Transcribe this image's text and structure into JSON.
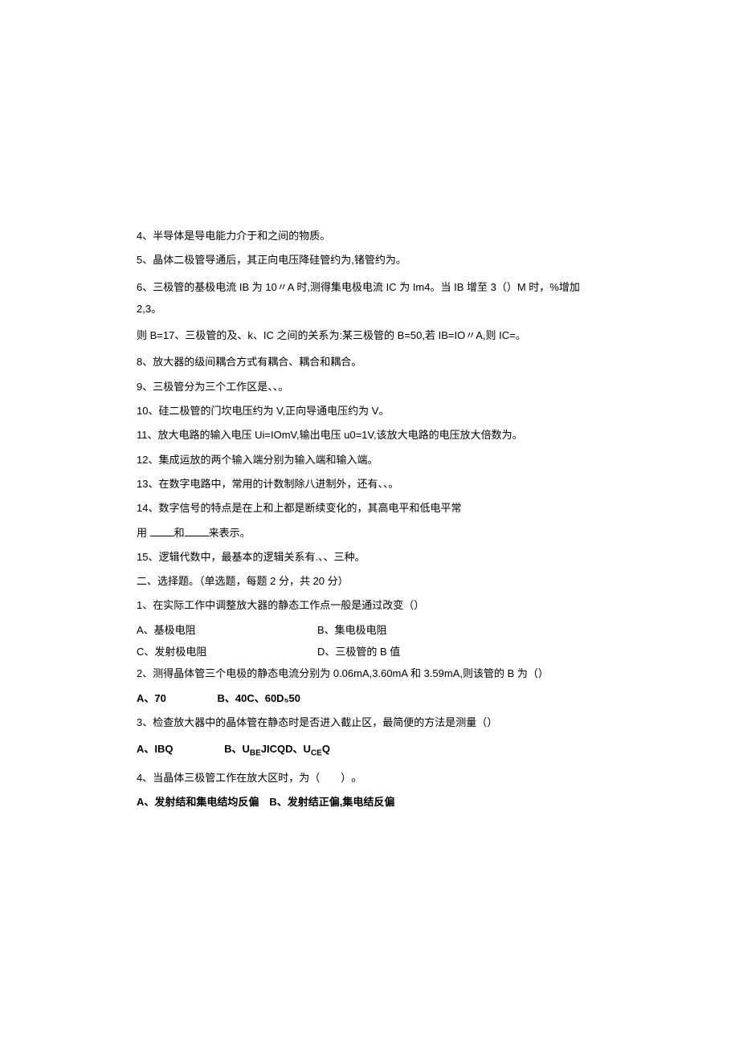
{
  "fill_blanks": {
    "q4": "4、半导体是导电能力介于和之间的物质。",
    "q5": "5、晶体二极管导通后，其正向电压降硅管约为,锗管约为。",
    "q6_line1": "6、三极管的基极电流 IB 为 10〃A 时,测得集电极电流 IC 为 Im4。当 IB 增至 3（）M 时，%增加 2,3。",
    "q6_line2": "则 B=17、三极管的及、k、IC 之间的关系为:某三极管的 B=50,若 IB=IO〃A,则 IC=。",
    "q8": "8、放大器的级间耦合方式有耦合、耦合和耦合。",
    "q9": "9、三极管分为三个工作区是、、。",
    "q10": "10、硅二极管的门坎电压约为 V,正向导通电压约为 V。",
    "q11": "11、放大电路的输入电压 Ui=IOmV,输出电压 u0=1V,该放大电路的电压放大倍数为。",
    "q12": "12、集成运放的两个输入端分别为输入端和输入端。",
    "q13": "13、在数字电路中，常用的计数制除八进制外，还有、、。",
    "q14_line1": "14、数字信号的特点是在上和上都是断续变化的，其高电平和低电平常",
    "q14_line2_prefix": "用 ",
    "q14_line2_mid": "和",
    "q14_line2_suffix": "来表示。",
    "q15": "15、逻辑代数中，最基本的逻辑关系有.、、三种。"
  },
  "section2_header": "二、选择题。（单选题，每题 2 分，共 20 分）",
  "choice": {
    "q1": {
      "stem": "1、在实际工作中调整放大器的静态工作点一般是通过改变（）",
      "optA": "A、基极电阻",
      "optB": "B、集电极电阻",
      "optC": "C、发射极电阻",
      "optD": "D、三极管的 B 值"
    },
    "q2": {
      "stem": "2、测得晶体管三个电极的静态电流分别为 0.06mA,3.60mA 和 3.59mA,则该管的 B 为（）",
      "optA": "A、70",
      "optBCD": "B、40C、60D₅50"
    },
    "q3": {
      "stem": "3、检查放大器中的晶体管在静态时是否进入截止区，最简便的方法是测量（）",
      "optA": "A、IBQ",
      "optB_prefix": "B、U",
      "optB_sub1": "BE",
      "optB_mid": "JICQD、U",
      "optB_sub2": "CE",
      "optB_suffix": "Q"
    },
    "q4": {
      "stem": "4、当晶体三极管工作在放大区时，为（　　）₀",
      "optA": "A、发射结和集电结均反偏",
      "optB": "B、发射结正偏,集电结反偏"
    }
  }
}
